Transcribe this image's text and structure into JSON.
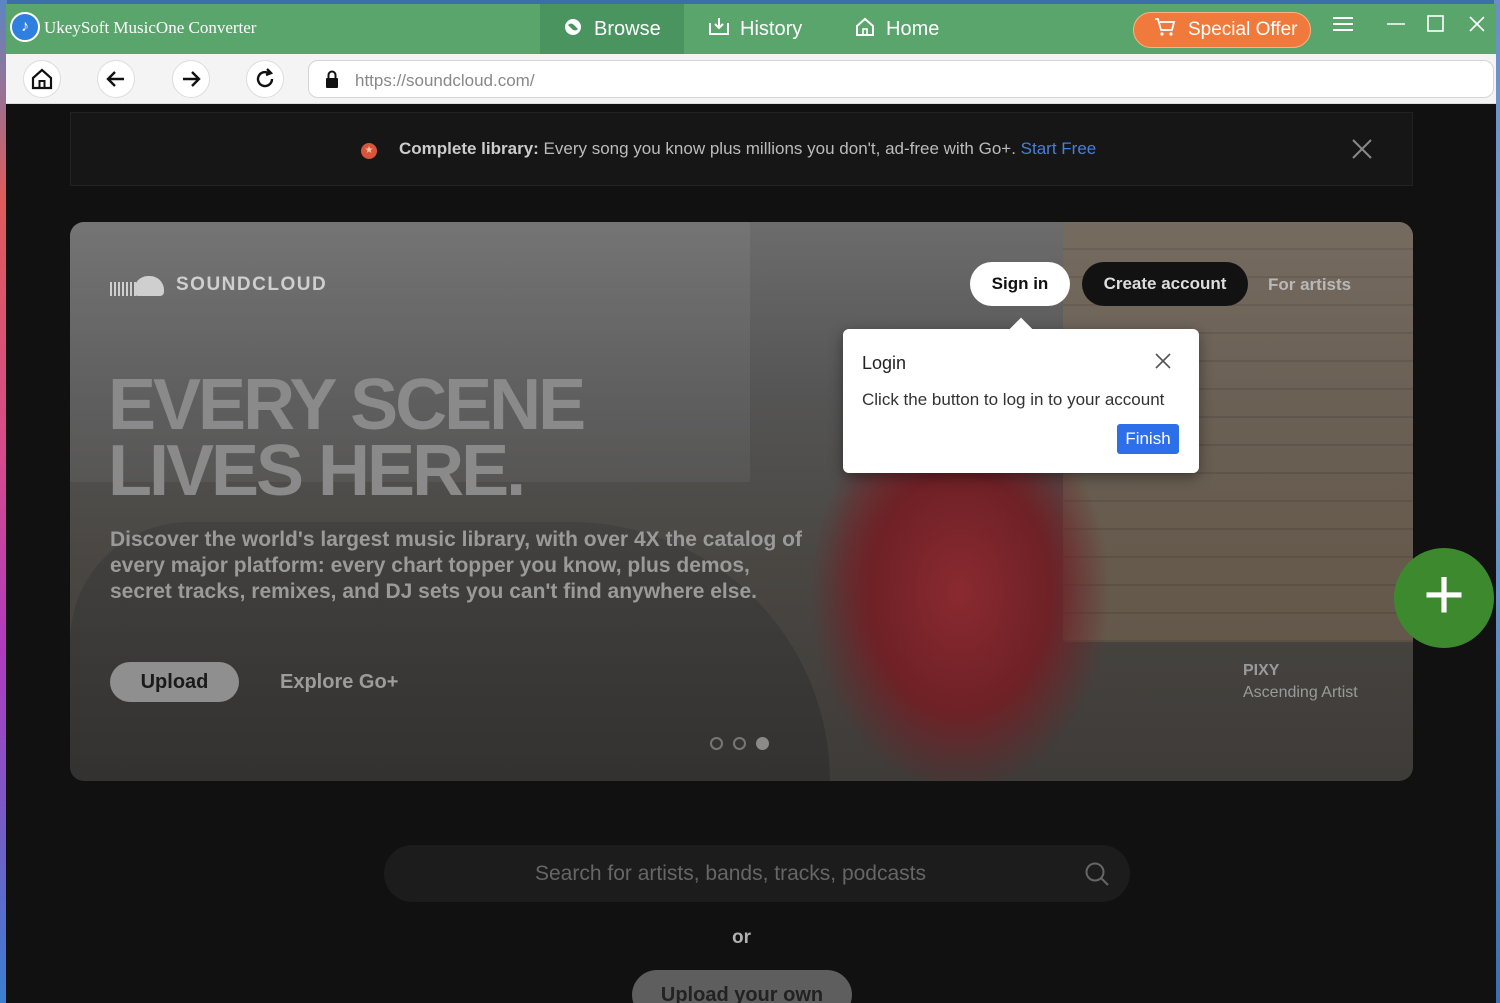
{
  "window": {
    "app_title": "UkeySoft MusicOne Converter",
    "tabs": [
      {
        "label": "Browse",
        "icon": "globe-icon",
        "active": true
      },
      {
        "label": "History",
        "icon": "download-icon",
        "active": false
      },
      {
        "label": "Home",
        "icon": "home-icon",
        "active": false
      }
    ],
    "special_offer": "Special Offer",
    "accent": "#5aa56c",
    "offer_color": "#f07a3c"
  },
  "toolbar": {
    "url": "https://soundcloud.com/"
  },
  "banner": {
    "bold": "Complete library:",
    "text": " Every song you know plus millions you don't, ad-free with Go+. ",
    "link": "Start Free"
  },
  "hero": {
    "brand": "SOUNDCLOUD",
    "sign_in": "Sign in",
    "create_account": "Create account",
    "for_artists": "For artists",
    "headline_1": "EVERY SCENE",
    "headline_2": "LIVES HERE.",
    "subcopy": "Discover the world's largest music library, with over 4X the catalog of every major platform: every chart topper you know, plus demos, secret tracks, remixes, and DJ sets you can't find anywhere else.",
    "upload": "Upload",
    "explore": "Explore Go+",
    "artist_name": "PIXY",
    "artist_sub": "Ascending Artist",
    "carousel_active": 3,
    "carousel_count": 3
  },
  "popup": {
    "title": "Login",
    "body": "Click the button to log in to your account",
    "finish": "Finish"
  },
  "search": {
    "placeholder": "Search for artists, bands, tracks, podcasts"
  },
  "or_text": "or",
  "upload_own": "Upload your own",
  "fab_symbol": "+"
}
